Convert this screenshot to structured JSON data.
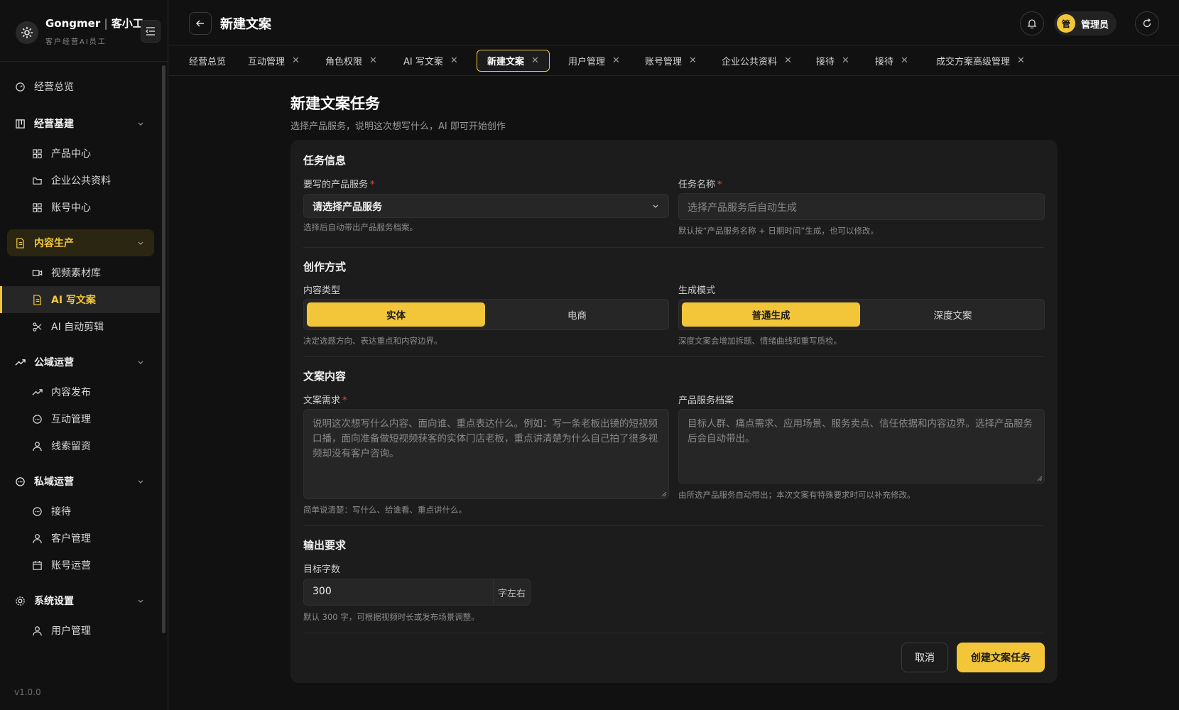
{
  "brand": {
    "name": "Gongmer",
    "separator": "|",
    "name_cn": "客小工",
    "subtitle": "客户经营AI员工"
  },
  "sidebar": {
    "items": [
      {
        "label": "经营总览",
        "icon": "dashboard-icon",
        "type": "top"
      },
      {
        "label": "经营基建",
        "icon": "building-icon",
        "type": "group"
      },
      {
        "label": "产品中心",
        "icon": "grid-icon",
        "type": "sub"
      },
      {
        "label": "企业公共资料",
        "icon": "folder-icon",
        "type": "sub"
      },
      {
        "label": "账号中心",
        "icon": "grid-icon",
        "type": "sub"
      },
      {
        "label": "内容生产",
        "icon": "document-icon",
        "type": "group",
        "active": true
      },
      {
        "label": "视频素材库",
        "icon": "video-icon",
        "type": "sub"
      },
      {
        "label": "AI 写文案",
        "icon": "document-icon",
        "type": "sub",
        "active": true
      },
      {
        "label": "AI 自动剪辑",
        "icon": "scissors-icon",
        "type": "sub"
      },
      {
        "label": "公域运营",
        "icon": "trend-icon",
        "type": "group"
      },
      {
        "label": "内容发布",
        "icon": "trend-icon",
        "type": "sub"
      },
      {
        "label": "互动管理",
        "icon": "chat-icon",
        "type": "sub"
      },
      {
        "label": "线索留资",
        "icon": "user-icon",
        "type": "sub"
      },
      {
        "label": "私域运营",
        "icon": "chat-icon",
        "type": "group"
      },
      {
        "label": "接待",
        "icon": "chat-icon",
        "type": "sub"
      },
      {
        "label": "客户管理",
        "icon": "user-icon",
        "type": "sub"
      },
      {
        "label": "账号运营",
        "icon": "calendar-icon",
        "type": "sub"
      },
      {
        "label": "系统设置",
        "icon": "gear-icon",
        "type": "group"
      },
      {
        "label": "用户管理",
        "icon": "user-icon",
        "type": "sub"
      }
    ],
    "version": "v1.0.0"
  },
  "header": {
    "title": "新建文案",
    "user_initial": "管",
    "user_name": "管理员"
  },
  "tabs": [
    {
      "label": "经营总览",
      "closable": false
    },
    {
      "label": "互动管理",
      "closable": true
    },
    {
      "label": "角色权限",
      "closable": true
    },
    {
      "label": "AI 写文案",
      "closable": true
    },
    {
      "label": "新建文案",
      "closable": true,
      "active": true
    },
    {
      "label": "用户管理",
      "closable": true
    },
    {
      "label": "账号管理",
      "closable": true
    },
    {
      "label": "企业公共资料",
      "closable": true
    },
    {
      "label": "接待",
      "closable": true
    },
    {
      "label": "接待",
      "closable": true
    },
    {
      "label": "成交方案高级管理",
      "closable": true
    }
  ],
  "main": {
    "title": "新建文案任务",
    "subtitle": "选择产品服务，说明这次想写什么，AI 即可开始创作",
    "task_info": {
      "title": "任务信息",
      "product_label": "要写的产品服务",
      "product_value": "请选择产品服务",
      "product_hint": "选择后自动带出产品服务档案。",
      "name_label": "任务名称",
      "name_placeholder": "选择产品服务后自动生成",
      "name_hint": "默认按“产品服务名称 + 日期时间”生成，也可以修改。"
    },
    "method": {
      "title": "创作方式",
      "content_type_label": "内容类型",
      "content_type_options": [
        "实体",
        "电商"
      ],
      "content_type_selected": "实体",
      "content_type_hint": "决定选题方向、表达重点和内容边界。",
      "mode_label": "生成模式",
      "mode_options": [
        "普通生成",
        "深度文案"
      ],
      "mode_selected": "普通生成",
      "mode_hint": "深度文案会增加拆题、情绪曲线和重写质检。"
    },
    "content": {
      "title": "文案内容",
      "req_label": "文案需求",
      "req_placeholder": "说明这次想写什么内容、面向谁、重点表达什么。例如：写一条老板出镜的短视频口播，面向准备做短视频获客的实体门店老板，重点讲清楚为什么自己拍了很多视频却没有客户咨询。",
      "req_hint": "简单说清楚：写什么、给谁看、重点讲什么。",
      "profile_label": "产品服务档案",
      "profile_placeholder": "目标人群、痛点需求、应用场景、服务卖点、信任依据和内容边界。选择产品服务后会自动带出。",
      "profile_hint": "由所选产品服务自动带出；本次文案有特殊要求时可以补充修改。"
    },
    "output": {
      "title": "输出要求",
      "words_label": "目标字数",
      "words_value": "300",
      "words_suffix": "字左右",
      "words_hint": "默认 300 字，可根据视频时长或发布场景调整。"
    },
    "actions": {
      "cancel": "取消",
      "submit": "创建文案任务"
    }
  },
  "colors": {
    "accent": "#f3c63a",
    "background": "#111111",
    "card": "#1c1c1c",
    "required": "#e0553d"
  }
}
